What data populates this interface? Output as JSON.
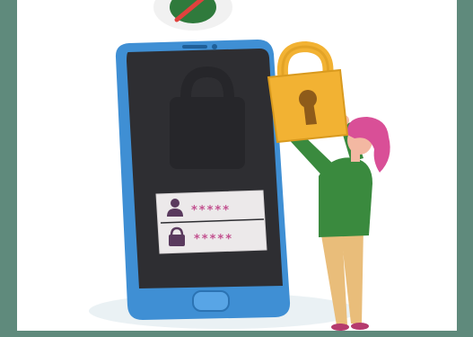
{
  "scene": {
    "background_color": "#5f8a7c",
    "card_color": "#ffffff",
    "phone": {
      "body_color": "#3f8fd4",
      "screen_color": "#2e2e32",
      "home_button_color": "#3f8fd4"
    },
    "login_card": {
      "card_color": "#ece9ea",
      "username_icon": "user-icon",
      "username_mask": "*****",
      "password_icon": "padlock-icon",
      "password_mask": "*****"
    },
    "big_padlock": {
      "icon": "padlock-icon",
      "body_color": "#f2b233",
      "keyhole_color": "#8e5b1a"
    },
    "top_badge": {
      "icon": "no-tracking-icon",
      "color": "#e0413d"
    },
    "person": {
      "hair_color": "#d94f97",
      "shirt_color": "#3a8a3e",
      "pants_color": "#e9bd7a",
      "skin_color": "#f3b8a2"
    }
  }
}
